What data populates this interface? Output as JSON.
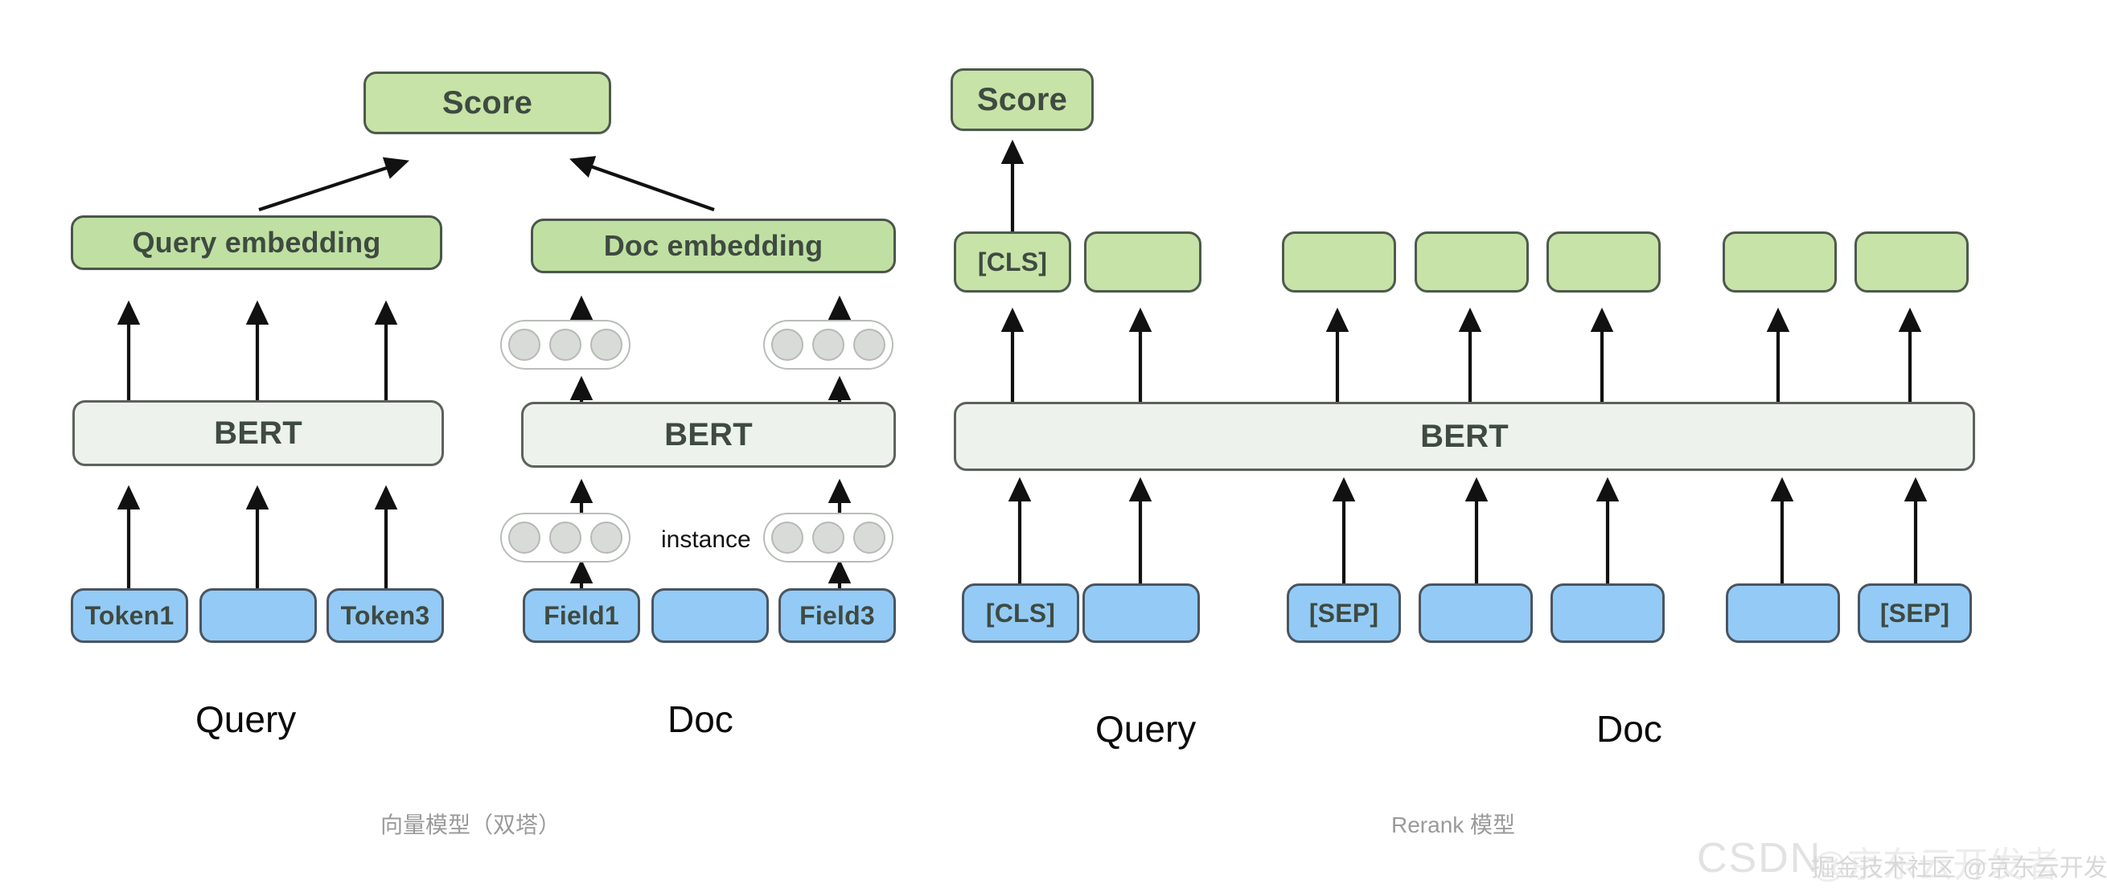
{
  "diagram": {
    "title_left": "向量模型（双塔）",
    "title_right": "Rerank 模型"
  },
  "left_model": {
    "score": "Score",
    "query_embedding": "Query embedding",
    "doc_embedding": "Doc embedding",
    "bert_query": "BERT",
    "bert_doc": "BERT",
    "instance_label": "instance",
    "query_tokens": [
      "Token1",
      "",
      "Token3"
    ],
    "doc_fields": [
      "Field1",
      "",
      "Field3"
    ],
    "query_section": "Query",
    "doc_section": "Doc"
  },
  "right_model": {
    "score": "Score",
    "bert": "BERT",
    "output_tokens": [
      "[CLS]",
      "",
      "",
      "",
      "",
      "",
      ""
    ],
    "input_tokens": [
      "[CLS]",
      "",
      "[SEP]",
      "",
      "",
      "",
      "[SEP]"
    ],
    "query_section": "Query",
    "doc_section": "Doc"
  },
  "watermark": {
    "csdn": "CSDN",
    "jd": "@京东云开发者",
    "juejin": "掘金技术社区 @京东云开发者"
  },
  "colors": {
    "green_fill": "#c7e3a8",
    "green_stroke": "#4d5a4d",
    "grey_fill": "#eef2ec",
    "grey_stroke": "#5a635a",
    "blue_fill": "#93cbf6",
    "blue_stroke": "#4a5560",
    "arrow": "#111111",
    "caption": "#9a9a9a"
  },
  "icons": {
    "arrow_up": "arrow-up-icon",
    "arrow_diagonal": "arrow-diagonal-icon",
    "dot": "dot-icon"
  }
}
